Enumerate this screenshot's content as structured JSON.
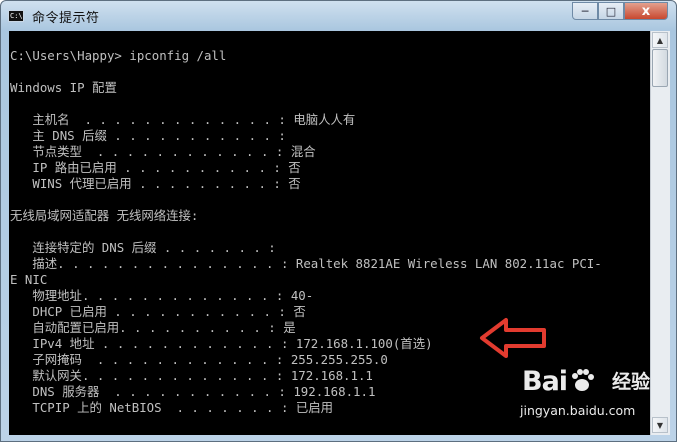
{
  "window": {
    "title": "命令提示符",
    "icon": "cmd-icon",
    "controls": {
      "minimize": "─",
      "maximize": "□",
      "close": "x"
    }
  },
  "console": {
    "lines": [
      "C:\\Users\\Happy> ipconfig /all",
      "",
      "Windows IP 配置",
      "",
      "   主机名  . . . . . . . . . . . . . : 电脑人人有",
      "   主 DNS 后缀 . . . . . . . . . . . :",
      "   节点类型  . . . . . . . . . . . . : 混合",
      "   IP 路由已启用 . . . . . . . . . . : 否",
      "   WINS 代理已启用 . . . . . . . . . : 否",
      "",
      "无线局域网适配器 无线网络连接:",
      "",
      "   连接特定的 DNS 后缀 . . . . . . . :",
      "   描述. . . . . . . . . . . . . . . : Realtek 8821AE Wireless LAN 802.11ac PCI-",
      "E NIC",
      "   物理地址. . . . . . . . . . . . . : 40-",
      "   DHCP 已启用 . . . . . . . . . . . : 否",
      "   自动配置已启用. . . . . . . . . . : 是",
      "   IPv4 地址 . . . . . . . . . . . . : 172.168.1.100(首选)",
      "   子网掩码  . . . . . . . . . . . . : 255.255.255.0",
      "   默认网关. . . . . . . . . . . . . : 172.168.1.1",
      "   DNS 服务器  . . . . . . . . . . . : 192.168.1.1",
      "   TCPIP 上的 NetBIOS  . . . . . . . : 已启用"
    ]
  },
  "annotation": {
    "arrow_color": "#e23b2f"
  },
  "watermark": {
    "brand": "Bai",
    "brand_suffix": "经验",
    "url": "jingyan.baidu.com"
  }
}
